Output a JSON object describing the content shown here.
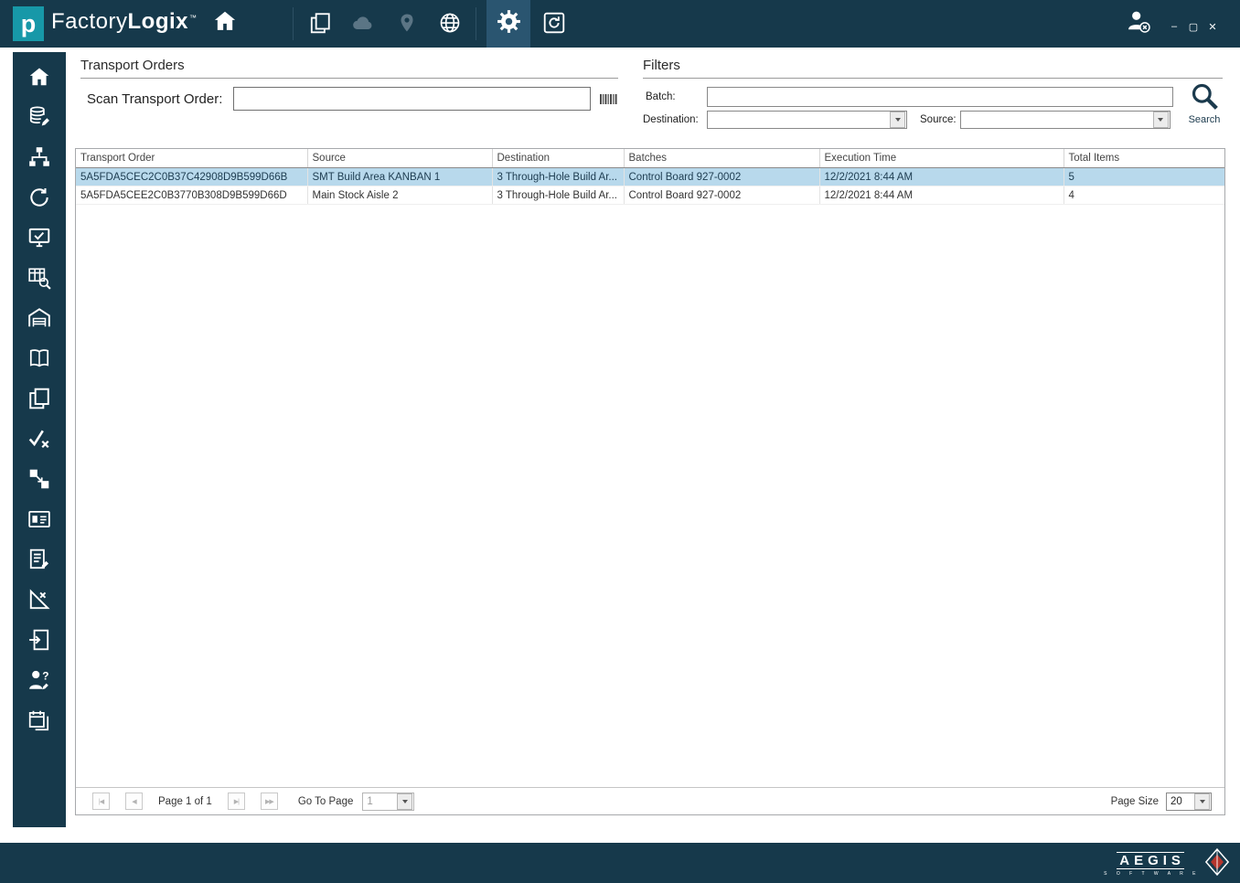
{
  "titlebar": {
    "logo_letter": "p",
    "app_name": "Factory",
    "app_name_bold": "Logix",
    "trademark": "™",
    "minimize_glyph": "–",
    "maximize_glyph": "▢",
    "close_glyph": "✕"
  },
  "sidebar": {
    "items": [
      "home",
      "data-setup",
      "process-definition",
      "history",
      "workstation",
      "lot-query",
      "warehouse",
      "documentation",
      "copy-orders",
      "validation",
      "material-transfer",
      "batch-details",
      "work-instructions",
      "design-check",
      "import-orders",
      "operator-support",
      "schedule"
    ]
  },
  "content": {
    "transport": {
      "title": "Transport Orders",
      "scan_label": "Scan Transport Order:",
      "scan_value": ""
    },
    "filters": {
      "title": "Filters",
      "batch_label": "Batch:",
      "batch_value": "",
      "destination_label": "Destination:",
      "destination_value": "",
      "source_label": "Source:",
      "source_value": "",
      "search_label": "Search"
    },
    "table": {
      "columns": [
        "Transport Order",
        "Source",
        "Destination",
        "Batches",
        "Execution Time",
        "Total Items"
      ],
      "rows": [
        [
          "5A5FDA5CEC2C0B37C42908D9B599D66B",
          "SMT Build Area KANBAN 1",
          "3 Through-Hole Build Ar...",
          "Control Board 927-0002",
          "12/2/2021 8:44 AM",
          "5"
        ],
        [
          "5A5FDA5CEE2C0B3770B308D9B599D66D",
          "Main Stock Aisle 2",
          "3 Through-Hole Build Ar...",
          "Control Board 927-0002",
          "12/2/2021 8:44 AM",
          "4"
        ]
      ],
      "selected_row_index": 0
    },
    "pager": {
      "first_glyph": "|◀",
      "prev_glyph": "◀",
      "next_glyph": "▶|",
      "last_glyph": "▶▶",
      "page_text": "Page 1 of 1",
      "goto_label": "Go To Page",
      "goto_value": "1",
      "page_size_label": "Page Size",
      "page_size_value": "20"
    }
  },
  "footer": {
    "brand": "AEGIS",
    "brand_sub": "S O F T W A R E"
  },
  "colors": {
    "titlebar_bg": "#16394b",
    "accent_teal": "#1798a8",
    "active_item_bg": "#2a5570",
    "selected_row": "#b8d9ec",
    "brand_red": "#b5342c"
  }
}
